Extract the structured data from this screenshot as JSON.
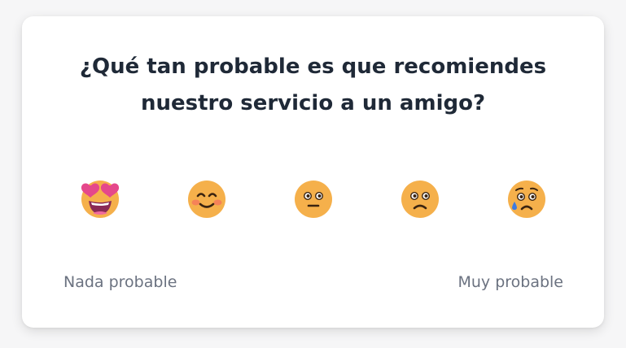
{
  "survey": {
    "question": "¿Qué tan probable es que recomiendes nuestro servicio a un amigo?",
    "options": [
      {
        "icon": "heart-eyes-face-icon"
      },
      {
        "icon": "smiling-face-icon"
      },
      {
        "icon": "neutral-face-icon"
      },
      {
        "icon": "frowning-face-icon"
      },
      {
        "icon": "sad-tear-face-icon"
      }
    ],
    "scale_low_label": "Nada probable",
    "scale_high_label": "Muy probable"
  },
  "colors": {
    "emoji_face": "#f5b04b",
    "hearts": "#e5488b",
    "text_primary": "#1f2937",
    "text_secondary": "#6b7280",
    "card_background": "#ffffff",
    "page_background": "#f6f6f7"
  }
}
